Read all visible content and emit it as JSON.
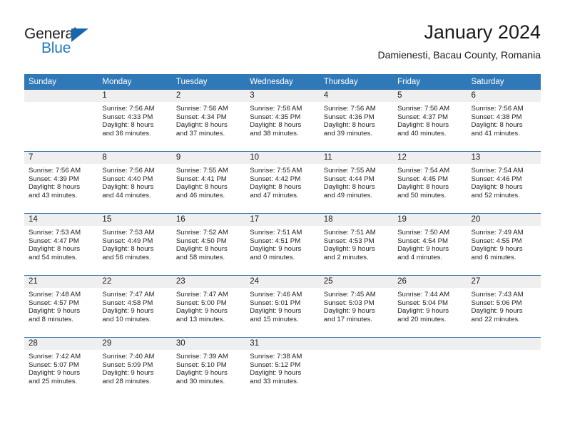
{
  "logo": {
    "word_one": "General",
    "word_two": "Blue",
    "icon": "triangle-icon"
  },
  "header": {
    "title": "January 2024",
    "subtitle": "Damienesti, Bacau County, Romania"
  },
  "colors": {
    "header_blue": "#3079b8",
    "grid_border_blue": "#2e6da4",
    "day_band_gray": "#efefef",
    "logo_blue": "#1f78c1"
  },
  "calendar": {
    "weekday_headers": [
      "Sunday",
      "Monday",
      "Tuesday",
      "Wednesday",
      "Thursday",
      "Friday",
      "Saturday"
    ],
    "weeks": [
      [
        {
          "day": "",
          "lines": []
        },
        {
          "day": "1",
          "lines": [
            "Sunrise: 7:56 AM",
            "Sunset: 4:33 PM",
            "Daylight: 8 hours",
            "and 36 minutes."
          ]
        },
        {
          "day": "2",
          "lines": [
            "Sunrise: 7:56 AM",
            "Sunset: 4:34 PM",
            "Daylight: 8 hours",
            "and 37 minutes."
          ]
        },
        {
          "day": "3",
          "lines": [
            "Sunrise: 7:56 AM",
            "Sunset: 4:35 PM",
            "Daylight: 8 hours",
            "and 38 minutes."
          ]
        },
        {
          "day": "4",
          "lines": [
            "Sunrise: 7:56 AM",
            "Sunset: 4:36 PM",
            "Daylight: 8 hours",
            "and 39 minutes."
          ]
        },
        {
          "day": "5",
          "lines": [
            "Sunrise: 7:56 AM",
            "Sunset: 4:37 PM",
            "Daylight: 8 hours",
            "and 40 minutes."
          ]
        },
        {
          "day": "6",
          "lines": [
            "Sunrise: 7:56 AM",
            "Sunset: 4:38 PM",
            "Daylight: 8 hours",
            "and 41 minutes."
          ]
        }
      ],
      [
        {
          "day": "7",
          "lines": [
            "Sunrise: 7:56 AM",
            "Sunset: 4:39 PM",
            "Daylight: 8 hours",
            "and 43 minutes."
          ]
        },
        {
          "day": "8",
          "lines": [
            "Sunrise: 7:56 AM",
            "Sunset: 4:40 PM",
            "Daylight: 8 hours",
            "and 44 minutes."
          ]
        },
        {
          "day": "9",
          "lines": [
            "Sunrise: 7:55 AM",
            "Sunset: 4:41 PM",
            "Daylight: 8 hours",
            "and 46 minutes."
          ]
        },
        {
          "day": "10",
          "lines": [
            "Sunrise: 7:55 AM",
            "Sunset: 4:42 PM",
            "Daylight: 8 hours",
            "and 47 minutes."
          ]
        },
        {
          "day": "11",
          "lines": [
            "Sunrise: 7:55 AM",
            "Sunset: 4:44 PM",
            "Daylight: 8 hours",
            "and 49 minutes."
          ]
        },
        {
          "day": "12",
          "lines": [
            "Sunrise: 7:54 AM",
            "Sunset: 4:45 PM",
            "Daylight: 8 hours",
            "and 50 minutes."
          ]
        },
        {
          "day": "13",
          "lines": [
            "Sunrise: 7:54 AM",
            "Sunset: 4:46 PM",
            "Daylight: 8 hours",
            "and 52 minutes."
          ]
        }
      ],
      [
        {
          "day": "14",
          "lines": [
            "Sunrise: 7:53 AM",
            "Sunset: 4:47 PM",
            "Daylight: 8 hours",
            "and 54 minutes."
          ]
        },
        {
          "day": "15",
          "lines": [
            "Sunrise: 7:53 AM",
            "Sunset: 4:49 PM",
            "Daylight: 8 hours",
            "and 56 minutes."
          ]
        },
        {
          "day": "16",
          "lines": [
            "Sunrise: 7:52 AM",
            "Sunset: 4:50 PM",
            "Daylight: 8 hours",
            "and 58 minutes."
          ]
        },
        {
          "day": "17",
          "lines": [
            "Sunrise: 7:51 AM",
            "Sunset: 4:51 PM",
            "Daylight: 9 hours",
            "and 0 minutes."
          ]
        },
        {
          "day": "18",
          "lines": [
            "Sunrise: 7:51 AM",
            "Sunset: 4:53 PM",
            "Daylight: 9 hours",
            "and 2 minutes."
          ]
        },
        {
          "day": "19",
          "lines": [
            "Sunrise: 7:50 AM",
            "Sunset: 4:54 PM",
            "Daylight: 9 hours",
            "and 4 minutes."
          ]
        },
        {
          "day": "20",
          "lines": [
            "Sunrise: 7:49 AM",
            "Sunset: 4:55 PM",
            "Daylight: 9 hours",
            "and 6 minutes."
          ]
        }
      ],
      [
        {
          "day": "21",
          "lines": [
            "Sunrise: 7:48 AM",
            "Sunset: 4:57 PM",
            "Daylight: 9 hours",
            "and 8 minutes."
          ]
        },
        {
          "day": "22",
          "lines": [
            "Sunrise: 7:47 AM",
            "Sunset: 4:58 PM",
            "Daylight: 9 hours",
            "and 10 minutes."
          ]
        },
        {
          "day": "23",
          "lines": [
            "Sunrise: 7:47 AM",
            "Sunset: 5:00 PM",
            "Daylight: 9 hours",
            "and 13 minutes."
          ]
        },
        {
          "day": "24",
          "lines": [
            "Sunrise: 7:46 AM",
            "Sunset: 5:01 PM",
            "Daylight: 9 hours",
            "and 15 minutes."
          ]
        },
        {
          "day": "25",
          "lines": [
            "Sunrise: 7:45 AM",
            "Sunset: 5:03 PM",
            "Daylight: 9 hours",
            "and 17 minutes."
          ]
        },
        {
          "day": "26",
          "lines": [
            "Sunrise: 7:44 AM",
            "Sunset: 5:04 PM",
            "Daylight: 9 hours",
            "and 20 minutes."
          ]
        },
        {
          "day": "27",
          "lines": [
            "Sunrise: 7:43 AM",
            "Sunset: 5:06 PM",
            "Daylight: 9 hours",
            "and 22 minutes."
          ]
        }
      ],
      [
        {
          "day": "28",
          "lines": [
            "Sunrise: 7:42 AM",
            "Sunset: 5:07 PM",
            "Daylight: 9 hours",
            "and 25 minutes."
          ]
        },
        {
          "day": "29",
          "lines": [
            "Sunrise: 7:40 AM",
            "Sunset: 5:09 PM",
            "Daylight: 9 hours",
            "and 28 minutes."
          ]
        },
        {
          "day": "30",
          "lines": [
            "Sunrise: 7:39 AM",
            "Sunset: 5:10 PM",
            "Daylight: 9 hours",
            "and 30 minutes."
          ]
        },
        {
          "day": "31",
          "lines": [
            "Sunrise: 7:38 AM",
            "Sunset: 5:12 PM",
            "Daylight: 9 hours",
            "and 33 minutes."
          ]
        },
        {
          "day": "",
          "lines": []
        },
        {
          "day": "",
          "lines": []
        },
        {
          "day": "",
          "lines": []
        }
      ]
    ]
  }
}
